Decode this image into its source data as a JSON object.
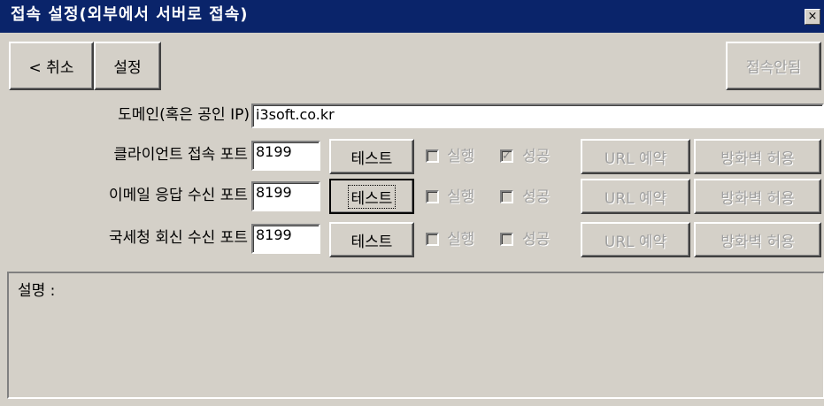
{
  "window": {
    "title": "접속 설정(외부에서 서버로 접속)",
    "close_glyph": "×"
  },
  "toolbar": {
    "cancel_label": "< 취소",
    "settings_label": "설정",
    "status_label": "접속안됨"
  },
  "domain": {
    "label": "도메인(혹은 공인 IP)",
    "value": "i3soft.co.kr"
  },
  "rows": [
    {
      "label": "클라이언트 접속 포트",
      "port": "8199",
      "test_label": "테스트",
      "run_label": "실행",
      "run_checked": false,
      "success_label": "성공",
      "success_checked": true,
      "url_label": "URL 예약",
      "firewall_label": "방화벽 허용"
    },
    {
      "label": "이메일 응답 수신 포트",
      "port": "8199",
      "test_label": "테스트",
      "run_label": "실행",
      "run_checked": false,
      "success_label": "성공",
      "success_checked": false,
      "url_label": "URL 예약",
      "firewall_label": "방화벽 허용"
    },
    {
      "label": "국세청 회신 수신 포트",
      "port": "8199",
      "test_label": "테스트",
      "run_label": "실행",
      "run_checked": false,
      "success_label": "성공",
      "success_checked": false,
      "url_label": "URL 예약",
      "firewall_label": "방화벽 허용"
    }
  ],
  "description": {
    "label": "설명 :"
  },
  "check_glyph": "✓"
}
